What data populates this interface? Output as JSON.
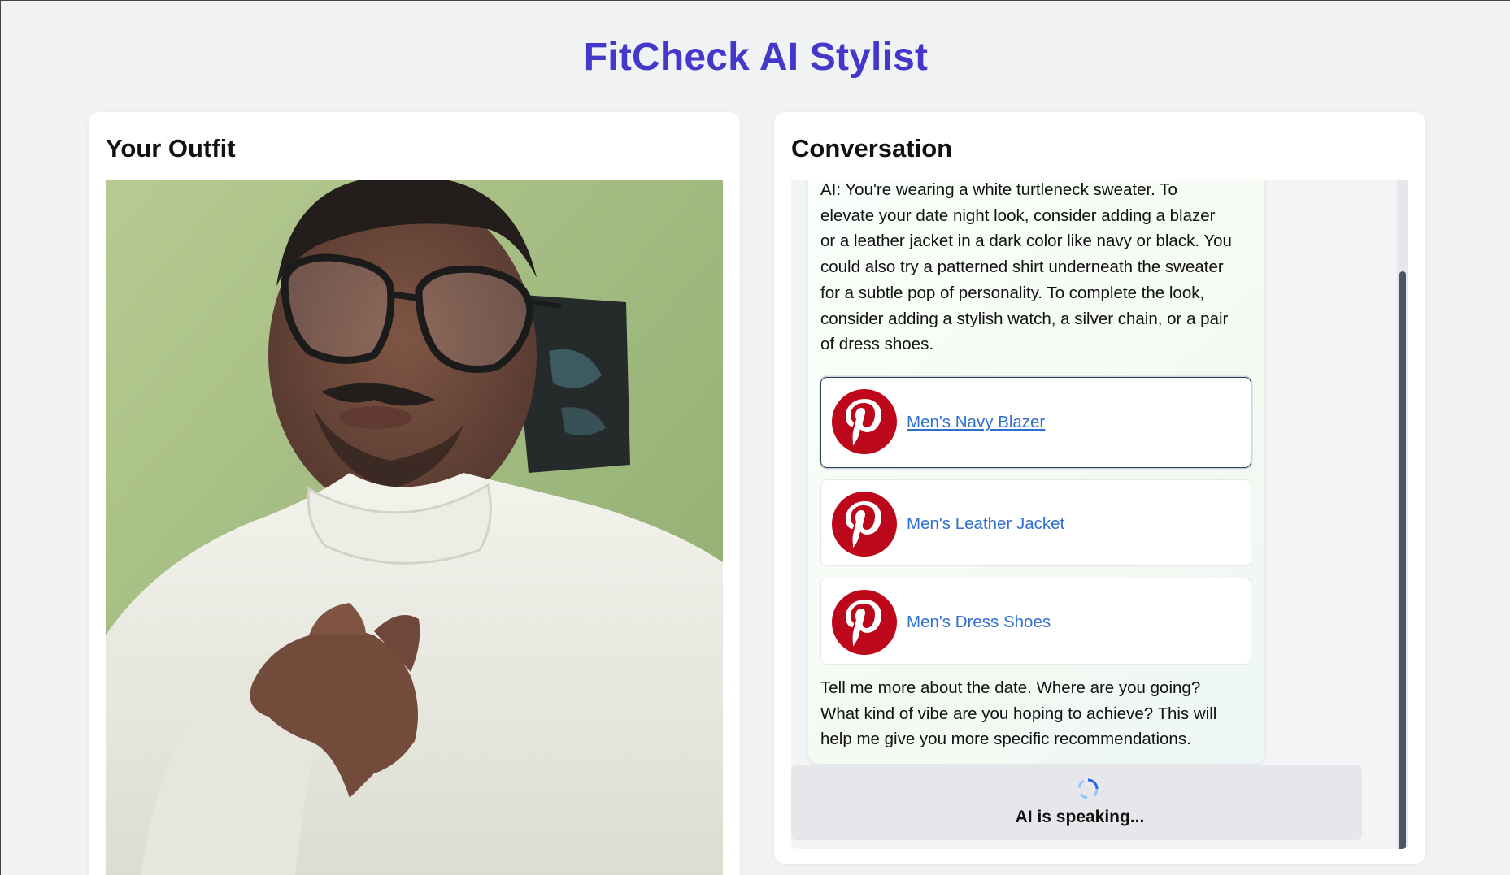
{
  "app": {
    "title": "FitCheck AI Stylist",
    "accent_color": "#4338ca"
  },
  "outfit_panel": {
    "title": "Your Outfit"
  },
  "conversation_panel": {
    "title": "Conversation",
    "ai_message": {
      "intro_lines": [
        "AI: You're wearing a white turtleneck sweater. To",
        "elevate your date night look, consider adding a blazer",
        "or a leather jacket in a dark color like navy or black. You",
        "could also try a patterned shirt underneath the sweater",
        "for a subtle pop of personality. To complete the look,",
        "consider adding a stylish watch, a silver chain, or a pair",
        "of dress shoes."
      ],
      "pinterest_links": [
        {
          "label": "Men's Navy Blazer",
          "icon": "pinterest-icon"
        },
        {
          "label": "Men's Leather Jacket",
          "icon": "pinterest-icon"
        },
        {
          "label": "Men's Dress Shoes",
          "icon": "pinterest-icon"
        }
      ],
      "followup_lines": [
        "Tell me more about the date. Where are you going?",
        "What kind of vibe are you hoping to achieve? This will",
        "help me give you more specific recommendations."
      ]
    },
    "status": {
      "text": "AI is speaking...",
      "icon": "loading-spinner-icon"
    }
  }
}
